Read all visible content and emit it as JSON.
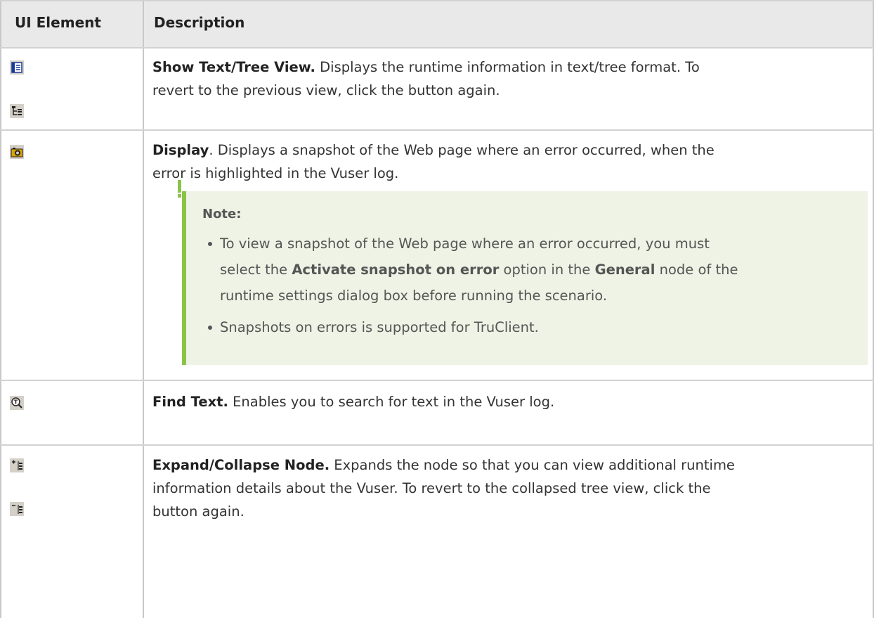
{
  "table": {
    "headers": {
      "ui_element": "UI Element",
      "description": "Description"
    },
    "rows": [
      {
        "icons": [
          "text-view-icon",
          "tree-view-icon"
        ],
        "title": "Show Text/Tree View.",
        "text1": "Displays the runtime information in text/tree format. To",
        "text2": "revert to the previous view, click the button again."
      },
      {
        "icons": [
          "camera-icon"
        ],
        "title": "Display",
        "text1": ". Displays a snapshot of the Web page where an error occurred, when the",
        "text2": "error is highlighted in the Vuser log.",
        "note": {
          "title": "Note:",
          "item1_line1": "To view a snapshot of the Web page where an error occurred, you must",
          "item1_line2_pre": "select the ",
          "item1_bold1": "Activate snapshot on error",
          "item1_line2_mid": " option in the ",
          "item1_bold2": "General",
          "item1_line2_post": " node of the",
          "item1_line3": "runtime settings dialog box before running the scenario.",
          "item2": "Snapshots on errors is supported for TruClient."
        }
      },
      {
        "icons": [
          "find-text-icon"
        ],
        "title": "Find Text.",
        "text1": " Enables you to search for text in the Vuser log."
      },
      {
        "icons": [
          "expand-node-icon",
          "collapse-node-icon"
        ],
        "title": "Expand/Collapse Node.",
        "text1": " Expands the node so that you can view additional runtime",
        "text2": "information details about the Vuser. To revert to the collapsed tree view, click the",
        "text3": "button again."
      }
    ]
  },
  "colors": {
    "header_bg": "#e9e9e9",
    "note_bg": "#eef3e5",
    "note_accent": "#8bc34a"
  }
}
